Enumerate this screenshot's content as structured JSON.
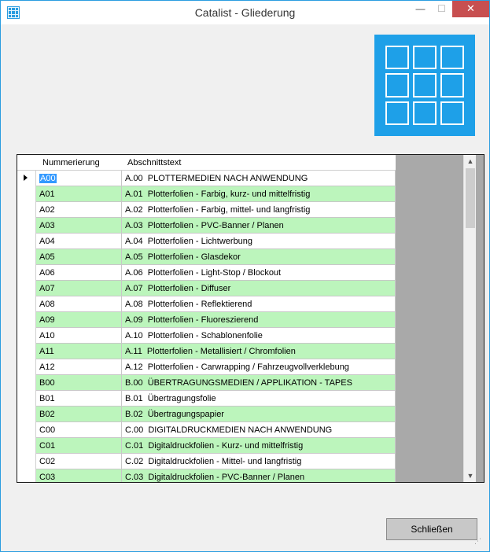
{
  "window": {
    "title": "Catalist - Gliederung",
    "minimize_glyph": "—",
    "maximize_glyph": "☐",
    "close_glyph": "✕"
  },
  "icons": {
    "app_icon": "grid-icon",
    "logo": "grid-logo-icon"
  },
  "colors": {
    "accent": "#1ea0e8",
    "odd_row": "#bcf5bc",
    "even_row": "#ffffff",
    "selection": "#3399ff",
    "close_button": "#c74f50"
  },
  "grid": {
    "columns": [
      "Nummerierung",
      "Abschnittstext"
    ],
    "rows": [
      {
        "nr": "A00",
        "text": "A.00  PLOTTERMEDIEN NACH ANWENDUNG"
      },
      {
        "nr": "A01",
        "text": "A.01  Plotterfolien - Farbig, kurz- und mittelfristig"
      },
      {
        "nr": "A02",
        "text": "A.02  Plotterfolien - Farbig, mittel- und langfristig"
      },
      {
        "nr": "A03",
        "text": "A.03  Plotterfolien - PVC-Banner / Planen"
      },
      {
        "nr": "A04",
        "text": "A.04  Plotterfolien - Lichtwerbung"
      },
      {
        "nr": "A05",
        "text": "A.05  Plotterfolien - Glasdekor"
      },
      {
        "nr": "A06",
        "text": "A.06  Plotterfolien - Light-Stop / Blockout"
      },
      {
        "nr": "A07",
        "text": "A.07  Plotterfolien - Diffuser"
      },
      {
        "nr": "A08",
        "text": "A.08  Plotterfolien - Reflektierend"
      },
      {
        "nr": "A09",
        "text": "A.09  Plotterfolien - Fluoreszierend"
      },
      {
        "nr": "A10",
        "text": "A.10  Plotterfolien - Schablonenfolie"
      },
      {
        "nr": "A11",
        "text": "A.11  Plotterfolien - Metallisiert / Chromfolien"
      },
      {
        "nr": "A12",
        "text": "A.12  Plotterfolien - Carwrapping / Fahrzeugvollverklebung"
      },
      {
        "nr": "B00",
        "text": "B.00  ÜBERTRAGUNGSMEDIEN / APPLIKATION - TAPES"
      },
      {
        "nr": "B01",
        "text": "B.01  Übertragungsfolie"
      },
      {
        "nr": "B02",
        "text": "B.02  Übertragungspapier"
      },
      {
        "nr": "C00",
        "text": "C.00  DIGITALDRUCKMEDIEN NACH ANWENDUNG"
      },
      {
        "nr": "C01",
        "text": "C.01  Digitaldruckfolien - Kurz- und mittelfristig"
      },
      {
        "nr": "C02",
        "text": "C.02  Digitaldruckfolien - Mittel- und langfristig"
      },
      {
        "nr": "C03",
        "text": "C.03  Digitaldruckfolien - PVC-Banner / Planen"
      }
    ]
  },
  "footer": {
    "close_label": "Schließen"
  }
}
